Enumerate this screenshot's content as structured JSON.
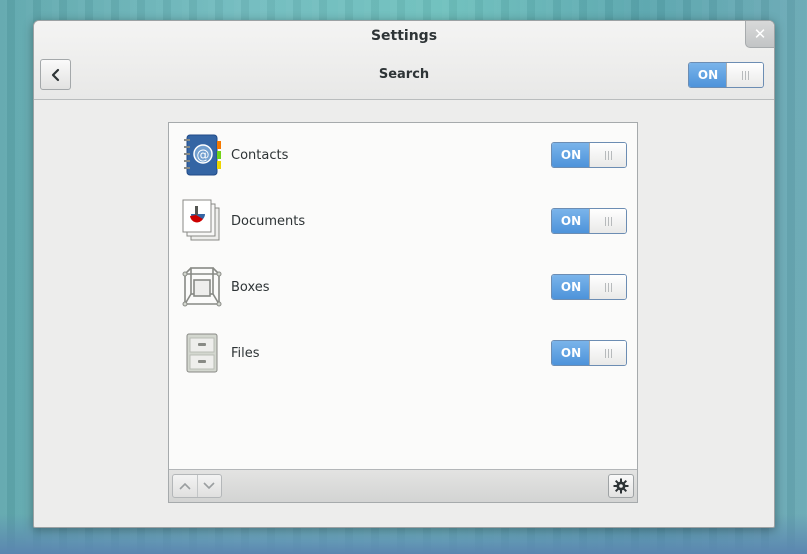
{
  "window": {
    "title": "Settings",
    "close_glyph": "✕"
  },
  "header": {
    "back_icon": "chevron-left-icon",
    "subtitle": "Search",
    "master_switch": "ON"
  },
  "providers": [
    {
      "name": "Contacts",
      "icon": "contacts-icon",
      "state": "ON"
    },
    {
      "name": "Documents",
      "icon": "documents-icon",
      "state": "ON"
    },
    {
      "name": "Boxes",
      "icon": "boxes-icon",
      "state": "ON"
    },
    {
      "name": "Files",
      "icon": "files-icon",
      "state": "ON"
    }
  ],
  "toolbar": {
    "up_icon": "chevron-up-icon",
    "down_icon": "chevron-down-icon",
    "settings_icon": "gear-icon"
  },
  "colors": {
    "switch_on": "#4d93da",
    "window_bg": "#ededec",
    "panel_bg": "#fbfbfa"
  }
}
